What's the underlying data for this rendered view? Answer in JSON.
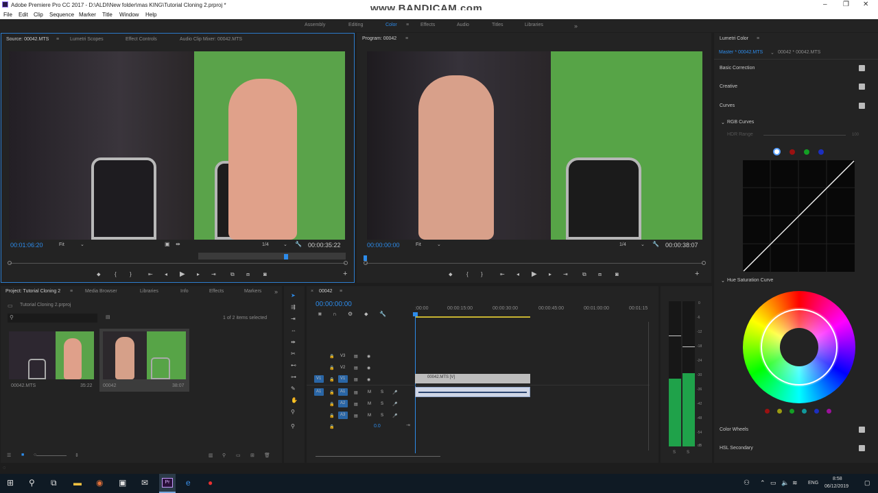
{
  "title": "Adobe Premiere Pro CC 2017 - D:\\ALDI\\New folder\\mas KING\\Tutorial Cloning 2.prproj *",
  "watermark": "www.BANDICAM.com",
  "menu": [
    "File",
    "Edit",
    "Clip",
    "Sequence",
    "Marker",
    "Title",
    "Window",
    "Help"
  ],
  "workspaces": [
    "Assembly",
    "Editing",
    "Color",
    "Effects",
    "Audio",
    "Titles",
    "Libraries"
  ],
  "source": {
    "tabs": [
      "Source: 00042.MTS",
      "Lumetri Scopes",
      "Effect Controls",
      "Audio Clip Mixer: 00042.MTS"
    ],
    "timecode": "00:01:06:20",
    "fit": "Fit",
    "quality": "1/4",
    "duration": "00:00:35:22"
  },
  "program": {
    "tab": "Program: 00042",
    "timecode": "00:00:00:00",
    "fit": "Fit",
    "quality": "1/4",
    "duration": "00:00:38:07"
  },
  "project": {
    "tabs": [
      "Project: Tutorial Cloning 2",
      "Media Browser",
      "Libraries",
      "Info",
      "Effects",
      "Markers"
    ],
    "file": "Tutorial Cloning 2.prproj",
    "selection": "1 of 2 items selected",
    "items": [
      {
        "name": "00042.MTS",
        "duration": "35:22"
      },
      {
        "name": "00042",
        "duration": "38:07"
      }
    ]
  },
  "timeline": {
    "tab": "00042",
    "timecode": "00:00:00:00",
    "ruler": [
      ":00:00",
      "00:00:15:00",
      "00:00:30:00",
      "00:00:45:00",
      "00:01:00:00",
      "00:01:15"
    ],
    "tracks": [
      "V3",
      "V2",
      "V1",
      "A1",
      "A2",
      "A3"
    ],
    "clip": "00042.MTS [V]",
    "master": "0.0"
  },
  "meter": [
    "0",
    "-6",
    "-12",
    "-18",
    "-24",
    "-30",
    "-36",
    "-42",
    "-48",
    "-54",
    "dB"
  ],
  "lumetri": {
    "title": "Lumetri Color",
    "master": "Master * 00042.MTS",
    "seq": "00042 * 00042.MTS",
    "sections": [
      "Basic Correction",
      "Creative",
      "Curves"
    ],
    "rgb": "RGB Curves",
    "hdr": "HDR Range",
    "hdr_val": "100",
    "hue": "Hue Saturation Curve",
    "sections2": [
      "Color Wheels",
      "HSL Secondary"
    ]
  },
  "taskbar": {
    "lang": "ENG",
    "time": "8:58",
    "date": "06/12/2019"
  }
}
